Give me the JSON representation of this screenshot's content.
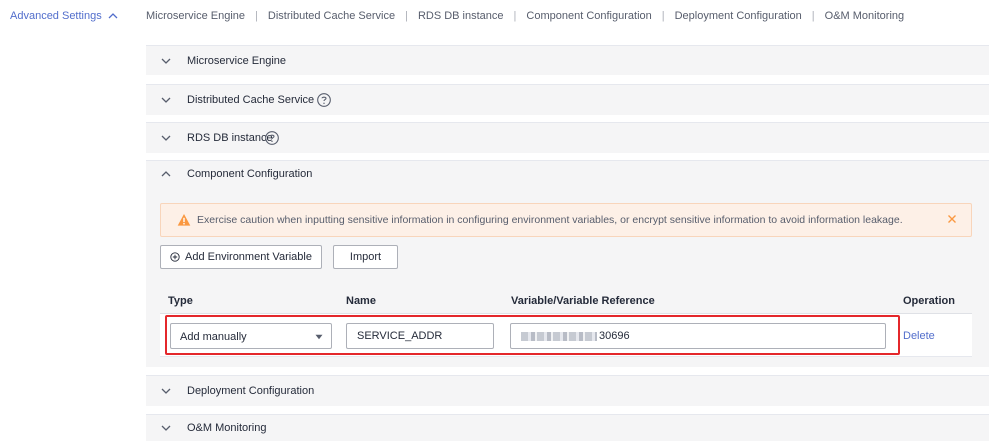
{
  "nav": {
    "advanced_settings": "Advanced Settings",
    "links": [
      "Microservice Engine",
      "Distributed Cache Service",
      "RDS DB instance",
      "Component Configuration",
      "Deployment Configuration",
      "O&M Monitoring"
    ]
  },
  "panels": {
    "microservice": "Microservice Engine",
    "dcs": "Distributed Cache Service",
    "rds": "RDS DB instance",
    "component": "Component Configuration",
    "deployment": "Deployment Configuration",
    "om": "O&M Monitoring"
  },
  "alert": {
    "message": "Exercise caution when inputting sensitive information in configuring environment variables, or encrypt sensitive information to avoid information leakage."
  },
  "buttons": {
    "add_env": "Add Environment Variable",
    "import": "Import"
  },
  "table": {
    "headers": [
      "Type",
      "Name",
      "Variable/Variable Reference",
      "Operation"
    ],
    "row": {
      "type": "Add manually",
      "name": "SERVICE_ADDR",
      "value_suffix": "30696",
      "operation": "Delete"
    }
  },
  "colors": {
    "link": "#526ecc",
    "warning": "#fa9841",
    "highlight": "#e4272b",
    "panel_bg": "#f5f5f6"
  },
  "icons": {
    "expand": "chevron-up-icon",
    "collapse": "chevron-down-icon",
    "help": "question-circle-icon",
    "warning": "warning-triangle-icon",
    "close": "close-icon",
    "add": "plus-circle-icon",
    "dropdown": "caret-down-icon"
  }
}
